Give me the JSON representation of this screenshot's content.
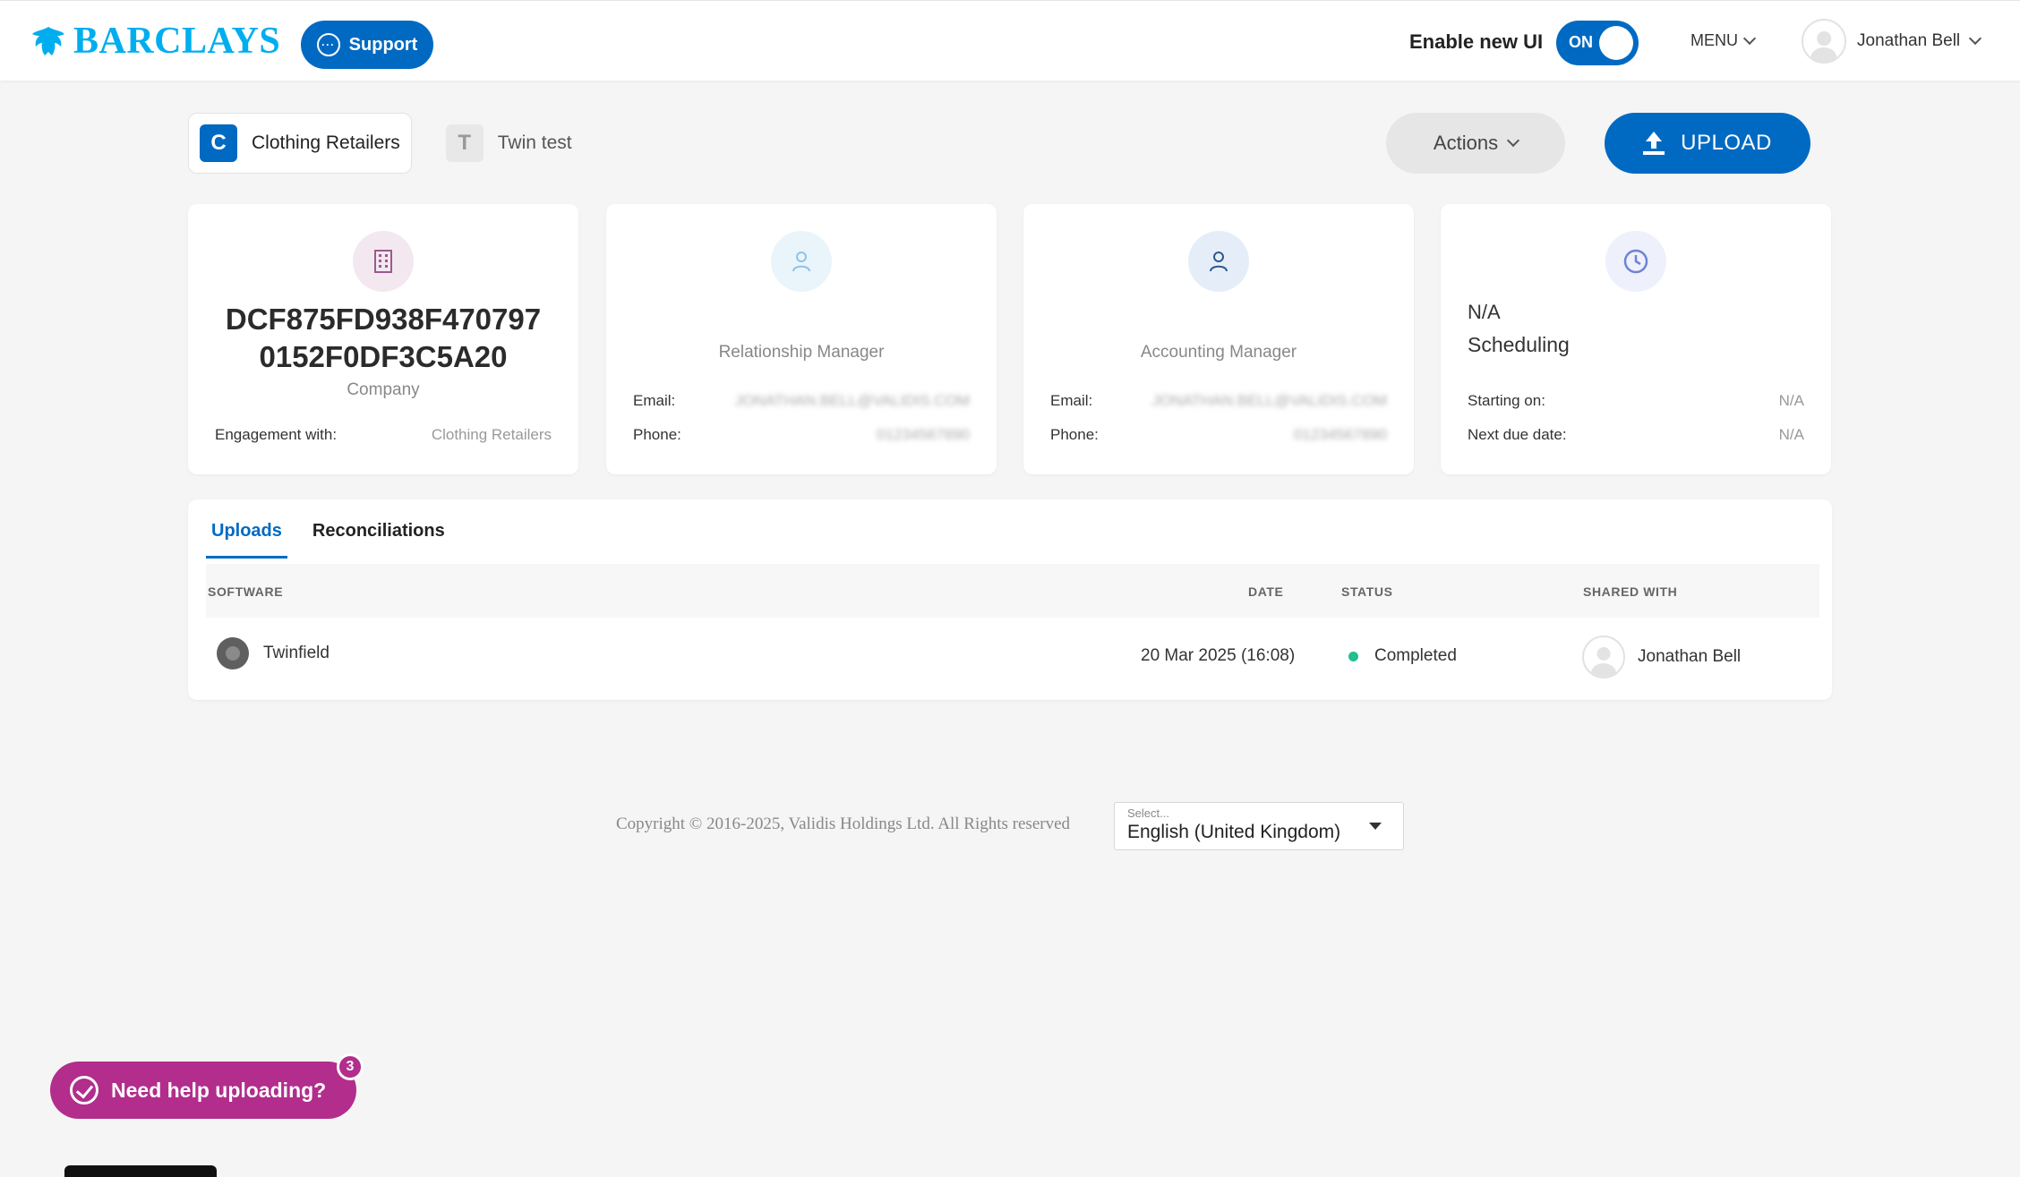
{
  "header": {
    "brand": "BARCLAYS",
    "support_label": "Support",
    "toggle_label": "Enable new UI",
    "toggle_state": "ON",
    "menu_label": "MENU",
    "user_name": "Jonathan Bell"
  },
  "org_tabs": [
    {
      "letter": "C",
      "label": "Clothing Retailers",
      "active": true
    },
    {
      "letter": "T",
      "label": "Twin test",
      "active": false
    }
  ],
  "actions_label": "Actions",
  "upload_label": "UPLOAD",
  "company_card": {
    "id": "DCF875FD938F4707970152F0DF3C5A20",
    "label": "Company",
    "engagement_label": "Engagement with:",
    "engagement_value": "Clothing Retailers"
  },
  "relationship_card": {
    "role": "Relationship Manager",
    "email_label": "Email:",
    "email_value": "JONATHAN.BELL@VALIDIS.COM",
    "phone_label": "Phone:",
    "phone_value": "01234567890"
  },
  "accounting_card": {
    "role": "Accounting Manager",
    "email_label": "Email:",
    "email_value": "JONATHAN.BELL@VALIDIS.COM",
    "phone_label": "Phone:",
    "phone_value": "01234567890"
  },
  "schedule_card": {
    "value": "N/A",
    "title": "Scheduling",
    "starting_label": "Starting on:",
    "starting_value": "N/A",
    "next_label": "Next due date:",
    "next_value": "N/A"
  },
  "panel": {
    "tabs": [
      "Uploads",
      "Reconciliations"
    ],
    "columns": {
      "software": "SOFTWARE",
      "date": "DATE",
      "status": "STATUS",
      "shared": "SHARED WITH"
    },
    "rows": [
      {
        "software": "Twinfield",
        "date": "20 Mar 2025 (16:08)",
        "status": "Completed",
        "shared_with": "Jonathan Bell"
      }
    ]
  },
  "footer": {
    "copyright": "Copyright © 2016-2025, Validis Holdings Ltd. All Rights reserved",
    "lang_placeholder": "Select...",
    "lang_value": "English (United Kingdom)"
  },
  "help": {
    "label": "Need help uploading?",
    "badge": "3"
  },
  "colors": {
    "primary": "#006ac3",
    "brand": "#00aeef",
    "help": "#b22d8c",
    "status_completed": "#1fbf8f"
  }
}
